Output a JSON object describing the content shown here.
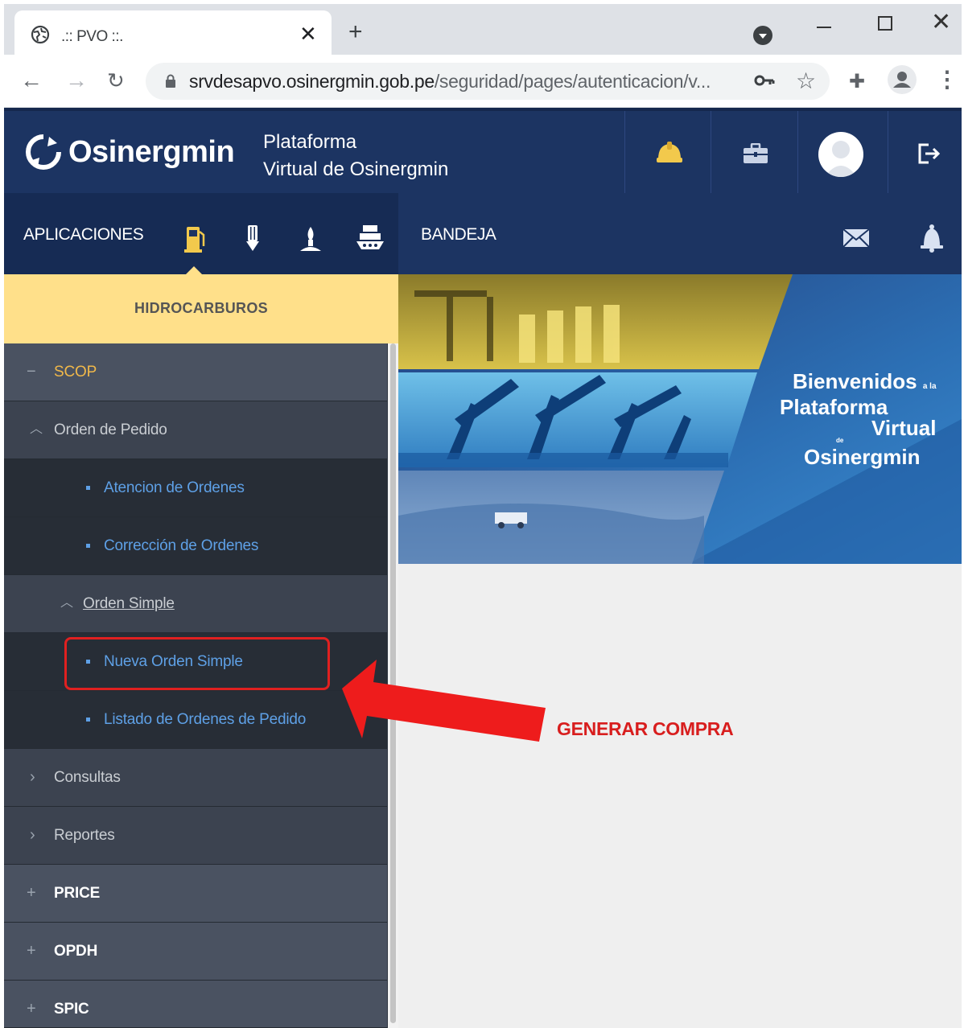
{
  "browser": {
    "tab_title": ".:: PVO ::.",
    "url_domain": "srvdesapvo.osinergmin.gob.pe",
    "url_path": "/seguridad/pages/autenticacion/v..."
  },
  "header": {
    "logo_text": "Osinergmin",
    "platform_line1": "Plataforma",
    "platform_line2": "Virtual de Osinergmin"
  },
  "apps_bar": {
    "label": "APLICACIONES",
    "icons": [
      "fuel-pump-icon",
      "electricity-icon",
      "gas-flame-icon",
      "ship-icon"
    ]
  },
  "bandeja": {
    "label": "BANDEJA"
  },
  "sidebar": {
    "section_title": "HIDROCARBUROS",
    "items": [
      {
        "label": "SCOP",
        "icon": "minus"
      },
      {
        "label": "Orden de Pedido",
        "icon": "chevron-up"
      },
      {
        "label": "Atencion de Ordenes",
        "icon": "bullet"
      },
      {
        "label": "Corrección de Ordenes",
        "icon": "bullet"
      },
      {
        "label": "Orden Simple",
        "icon": "chevron-up"
      },
      {
        "label": "Nueva Orden Simple",
        "icon": "bullet"
      },
      {
        "label": "Listado de Ordenes de Pedido",
        "icon": "bullet"
      },
      {
        "label": "Consultas",
        "icon": "chevron-right"
      },
      {
        "label": "Reportes",
        "icon": "chevron-right"
      },
      {
        "label": "PRICE",
        "icon": "plus"
      },
      {
        "label": "OPDH",
        "icon": "plus"
      },
      {
        "label": "SPIC",
        "icon": "plus"
      }
    ]
  },
  "banner": {
    "line1": "Bienvenidos",
    "line1_small": "a la",
    "line2": "Plataforma",
    "line3": "Virtual",
    "line3_small": "de",
    "line4": "Osinergmin"
  },
  "annotation": {
    "label": "GENERAR COMPRA",
    "color": "#d81e1e"
  },
  "colors": {
    "header_bg": "#1c3462",
    "sidebar_bg": "#2f3641",
    "section_bg": "#ffe08a",
    "active_item": "#f0b84a",
    "link_blue": "#5ea0e6"
  }
}
